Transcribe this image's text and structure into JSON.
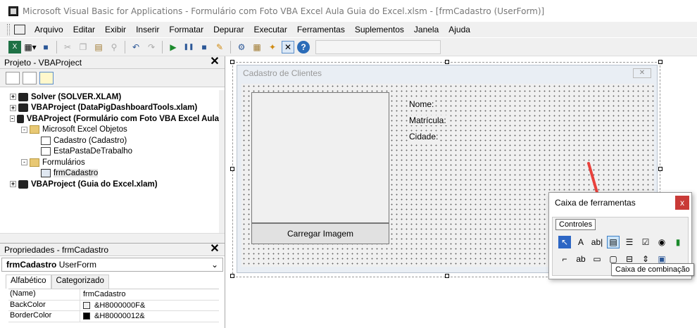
{
  "window": {
    "title": "Microsoft Visual Basic for Applications - Formulário com Foto VBA Excel Aula Guia do Excel.xlsm - [frmCadastro (UserForm)]"
  },
  "menu": [
    "Arquivo",
    "Editar",
    "Exibir",
    "Inserir",
    "Formatar",
    "Depurar",
    "Executar",
    "Ferramentas",
    "Suplementos",
    "Janela",
    "Ajuda"
  ],
  "project_pane": {
    "title": "Projeto - VBAProject",
    "tree": [
      {
        "label": "Solver (SOLVER.XLAM)",
        "level": 0,
        "expander": "+",
        "icon": "vba-project-icon",
        "bold": true
      },
      {
        "label": "VBAProject (DataPigDashboardTools.xlam)",
        "level": 0,
        "expander": "+",
        "icon": "vba-project-icon",
        "bold": true
      },
      {
        "label": "VBAProject (Formulário com Foto VBA Excel Aula",
        "level": 0,
        "expander": "-",
        "icon": "vba-project-icon",
        "bold": true
      },
      {
        "label": "Microsoft Excel Objetos",
        "level": 1,
        "expander": "-",
        "icon": "folder-icon",
        "bold": false
      },
      {
        "label": "Cadastro (Cadastro)",
        "level": 2,
        "expander": "",
        "icon": "worksheet-icon",
        "bold": false
      },
      {
        "label": "EstaPastaDeTrabalho",
        "level": 2,
        "expander": "",
        "icon": "workbook-icon",
        "bold": false
      },
      {
        "label": "Formulários",
        "level": 1,
        "expander": "-",
        "icon": "folder-icon",
        "bold": false
      },
      {
        "label": "frmCadastro",
        "level": 2,
        "expander": "",
        "icon": "userform-icon",
        "bold": false,
        "selected": true
      },
      {
        "label": "VBAProject (Guia do Excel.xlam)",
        "level": 0,
        "expander": "+",
        "icon": "vba-project-icon",
        "bold": true
      }
    ]
  },
  "properties_pane": {
    "title": "Propriedades - frmCadastro",
    "object_name": "frmCadastro",
    "object_type": "UserForm",
    "tabs": [
      "Alfabético",
      "Categorizado"
    ],
    "rows": [
      {
        "name": "(Name)",
        "value": "frmCadastro",
        "swatch": ""
      },
      {
        "name": "BackColor",
        "value": "&H8000000F&",
        "swatch": "#f0f0f0"
      },
      {
        "name": "BorderColor",
        "value": "&H80000012&",
        "swatch": "#000000"
      }
    ]
  },
  "userform": {
    "caption": "Cadastro de Clientes",
    "button_label": "Carregar Imagem",
    "labels": [
      "Nome:",
      "Matrícula:",
      "Cidade:"
    ]
  },
  "toolbox": {
    "title": "Caixa de ferramentas",
    "close": "x",
    "tab": "Controles",
    "controls_row1": [
      {
        "name": "select-objects-icon",
        "glyph": "↖"
      },
      {
        "name": "label-control-icon",
        "glyph": "A"
      },
      {
        "name": "textbox-control-icon",
        "glyph": "ab|"
      },
      {
        "name": "combobox-control-icon",
        "glyph": "▤"
      },
      {
        "name": "listbox-control-icon",
        "glyph": "☰"
      },
      {
        "name": "checkbox-control-icon",
        "glyph": "☑"
      },
      {
        "name": "optionbutton-control-icon",
        "glyph": "◉"
      },
      {
        "name": "togglebutton-control-icon",
        "glyph": "▮"
      }
    ],
    "controls_row2": [
      {
        "name": "frame-control-icon",
        "glyph": "⌐"
      },
      {
        "name": "commandbutton-control-icon",
        "glyph": "ab"
      },
      {
        "name": "tabstrip-control-icon",
        "glyph": "▭"
      },
      {
        "name": "multipage-control-icon",
        "glyph": "▢"
      },
      {
        "name": "scrollbar-control-icon",
        "glyph": "⊟"
      },
      {
        "name": "spinbutton-control-icon",
        "glyph": "⇕"
      },
      {
        "name": "image-control-icon",
        "glyph": "▣"
      }
    ],
    "tooltip": "Caixa de combinação"
  },
  "colors": {
    "annotation_arrow": "#e8413c",
    "selected_control": "#3c7fc5"
  }
}
